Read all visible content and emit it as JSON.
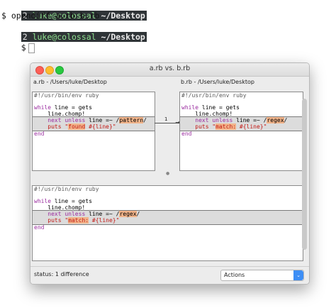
{
  "terminal": {
    "lines": [
      {
        "num": "2",
        "host": "luke@colossal",
        "path": "~/Desktop"
      },
      {
        "cmd": "$ opendiff a.rb b.rb"
      },
      {
        "num": "2",
        "host": "luke@colossal",
        "path": "~/Desktop"
      },
      {
        "cmd": "$"
      }
    ]
  },
  "window": {
    "title": "a.rb vs. b.rb",
    "left_pane_label": "a.rb - /Users/luke/Desktop",
    "right_pane_label": "b.rb - /Users/luke/Desktop",
    "status": "status: 1 difference",
    "actions_label": "Actions"
  },
  "code": {
    "shebang": "#!/usr/bin/env ruby",
    "while_kw": "while",
    "while_rest": " line = gets",
    "chomp": "    line.chomp!",
    "next_kw": "    next",
    "unless_kw": "unless",
    "unless_rest": " line =~ /",
    "left_pattern": "pattern",
    "right_pattern": "regex",
    "slash": "/",
    "puts_left_pre": "    puts \"",
    "left_word": "found",
    "right_word": "match:",
    "interp": " #{line}\"",
    "end_kw": "end"
  },
  "diff": {
    "connector_number": "1",
    "arrow": "→"
  }
}
